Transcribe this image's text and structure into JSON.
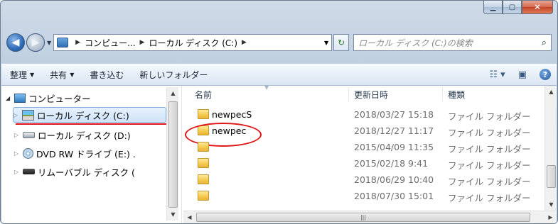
{
  "window": {
    "caption_buttons": [
      "minimize",
      "maximize",
      "close"
    ]
  },
  "address_bar": {
    "breadcrumbs": [
      "コンピュー...",
      "ローカル ディスク (C:)"
    ],
    "search_placeholder": "ローカル ディスク (C:)の検索",
    "icons": [
      "back-arrow-icon",
      "forward-arrow-icon",
      "refresh-icon",
      "search-icon"
    ]
  },
  "toolbar": {
    "organize": "整理",
    "share": "共有",
    "burn": "書き込む",
    "new_folder": "新しいフォルダー",
    "icons": [
      "view-options-icon",
      "preview-pane-icon",
      "help-icon"
    ]
  },
  "nav_tree": [
    {
      "label": "コンピューター",
      "icon": "computer-icon",
      "expanded": true
    },
    {
      "label": "ローカル ディスク (C:)",
      "icon": "local-disk-icon",
      "selected": true
    },
    {
      "label": "ローカル ディスク (D:)",
      "icon": "hard-disk-icon"
    },
    {
      "label": "DVD RW ドライブ (E:) .",
      "icon": "dvd-drive-icon"
    },
    {
      "label": "リムーバブル ディスク (",
      "icon": "removable-disk-icon"
    }
  ],
  "columns": {
    "name": "名前",
    "date": "更新日時",
    "type": "種類"
  },
  "files": [
    {
      "name": "newpecS",
      "date": "2018/03/27 15:18",
      "type": "ファイル フォルダー"
    },
    {
      "name": "newpec",
      "date": "2018/12/27 11:17",
      "type": "ファイル フォルダー",
      "highlighted": true
    },
    {
      "name": "",
      "date": "2015/04/09 11:35",
      "type": "ファイル フォルダー"
    },
    {
      "name": "",
      "date": "2015/02/18 9:41",
      "type": "ファイル フォルダー"
    },
    {
      "name": "",
      "date": "2018/06/29 10:40",
      "type": "ファイル フォルダー"
    },
    {
      "name": "",
      "date": "2018/07/30 15:01",
      "type": "ファイル フォルダー"
    }
  ],
  "colors": {
    "annotation_red": "#e01515",
    "selection_blue": "#cfe4f9"
  }
}
